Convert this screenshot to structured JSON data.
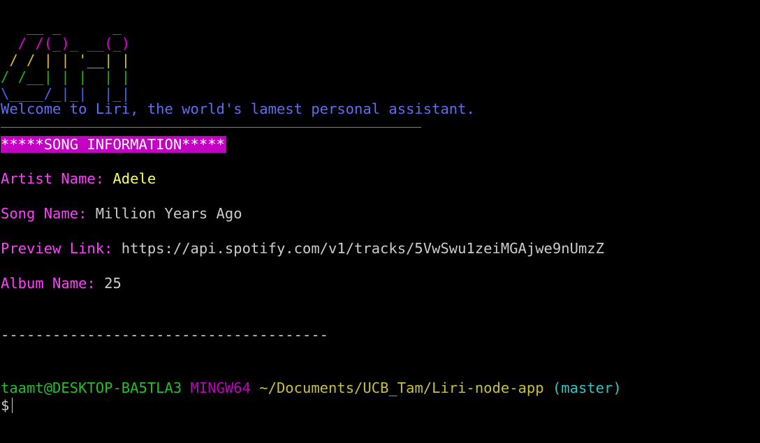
{
  "ascii_art": [
    "   __ _      _",
    "  / /(_)_ __(_)",
    " / / | | '__| |",
    "/ /__| | |  | |",
    "\\____/_|_|  |_|"
  ],
  "welcome": "Welcome to Liri, the world's lamest personal assistant.",
  "song_header": "*****SONG INFORMATION*****",
  "fields": [
    {
      "label": "Artist Name: ",
      "value": "Adele"
    },
    {
      "label": "Song Name: ",
      "value": "Million Years Ago"
    },
    {
      "label": "Preview Link: ",
      "value": "https://api.spotify.com/v1/tracks/5VwSwu1zeiMGAjwe9nUmzZ"
    },
    {
      "label": "Album Name: ",
      "value": "25"
    }
  ],
  "separator": "--------------------------------------",
  "prompt": {
    "user_host": "taamt@DESKTOP-BA5TLA3",
    "system": "MINGW64",
    "path": "~/Documents/UCB_Tam/Liri-node-app",
    "branch": "(master)",
    "symbol": "$"
  },
  "colors": {
    "background": "#000000",
    "header_bg": "#c400c4",
    "label": "#ff40ff",
    "user_host": "#22c02a",
    "system": "#c000c0",
    "path": "#c8c040",
    "branch": "#30c8c8"
  }
}
